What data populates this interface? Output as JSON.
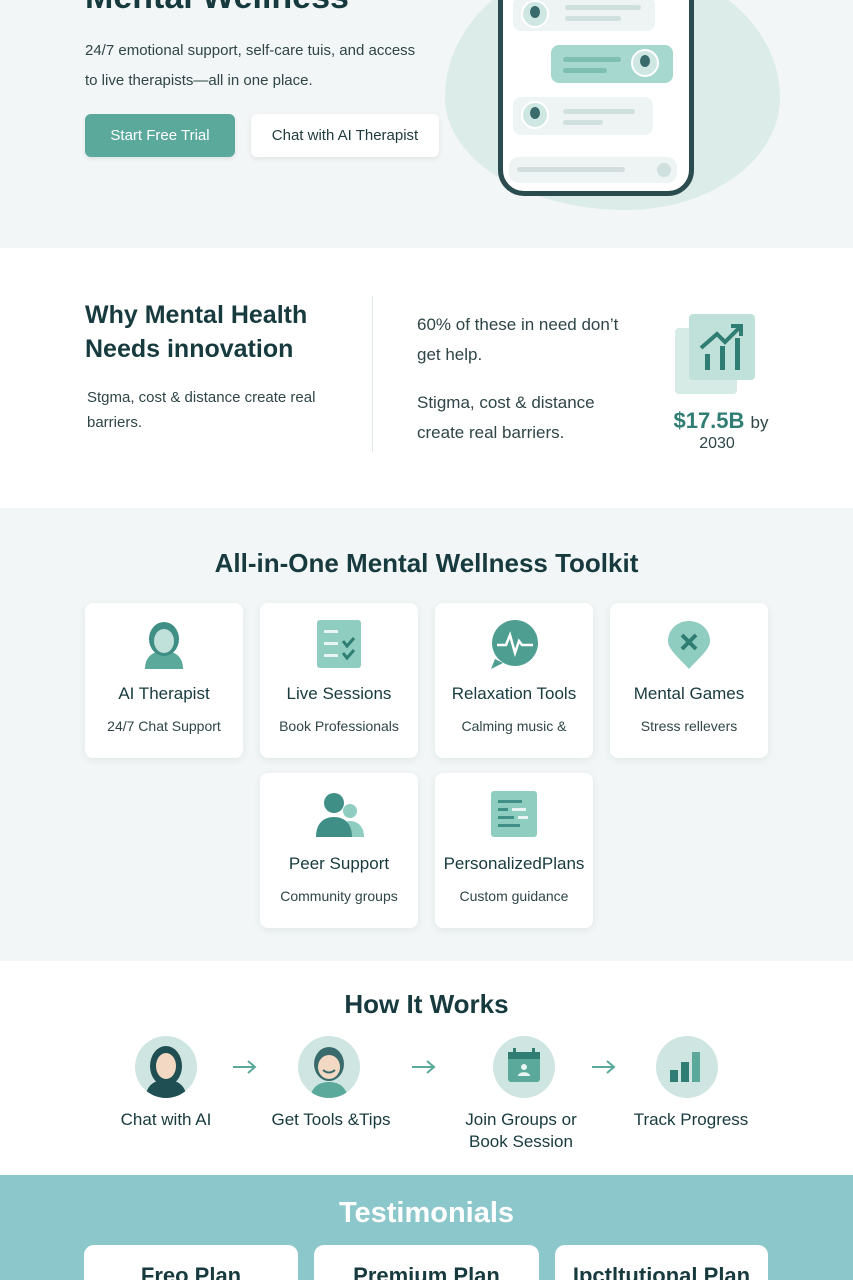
{
  "hero": {
    "title": "Mental Wellness",
    "subtitle": "24/7 emotional support, self-care tuis, and access to live therapists—all in one place.",
    "primary_cta": "Start Free Trial",
    "secondary_cta": "Chat with AI Therapist"
  },
  "why": {
    "title": "Why Mental Health Needs innovation",
    "left_text": "Stgma, cost & distance create real barriers.",
    "stat1": "60% of these in need don’t get help.",
    "stat2": "Stigma, cost & distance create real barriers.",
    "market_value": "$17.5B",
    "market_by": "by",
    "market_year": "2030"
  },
  "toolkit": {
    "title": "All-in-One Mental Wellness Toolkit",
    "cards": [
      {
        "title": "AI Therapist",
        "sub": "24/7 Chat Support",
        "icon": "therapist-avatar-icon"
      },
      {
        "title": "Live Sessions",
        "sub": "Book Professionals",
        "icon": "checklist-icon"
      },
      {
        "title": "Relaxation Tools",
        "sub": "Calming music &",
        "icon": "heartbeat-chat-icon"
      },
      {
        "title": "Mental Games",
        "sub": "Stress rellevers",
        "icon": "game-pin-icon"
      },
      {
        "title": "Peer Support",
        "sub": "Community groups",
        "icon": "people-icon"
      },
      {
        "title": "PersonalizedPlans",
        "sub": "Custom guidance",
        "icon": "plan-document-icon"
      }
    ]
  },
  "how": {
    "title": "How It Works",
    "steps": [
      {
        "label": "Chat with AI",
        "icon": "woman-avatar-icon"
      },
      {
        "label": "Get Tools &Tips",
        "icon": "smiling-person-icon"
      },
      {
        "label": "Join Groups or Book Session",
        "icon": "calendar-icon"
      },
      {
        "label": "Track Progress",
        "icon": "bar-chart-icon"
      }
    ]
  },
  "testimonials": {
    "title": "Testimonials",
    "plans": [
      "Freo Plan",
      "Premium Plan",
      "Ipctltutional Plan"
    ]
  },
  "colors": {
    "accent": "#5aa99b",
    "dark_text": "#173a3e",
    "testimonial_bg": "#8cc7cb"
  }
}
